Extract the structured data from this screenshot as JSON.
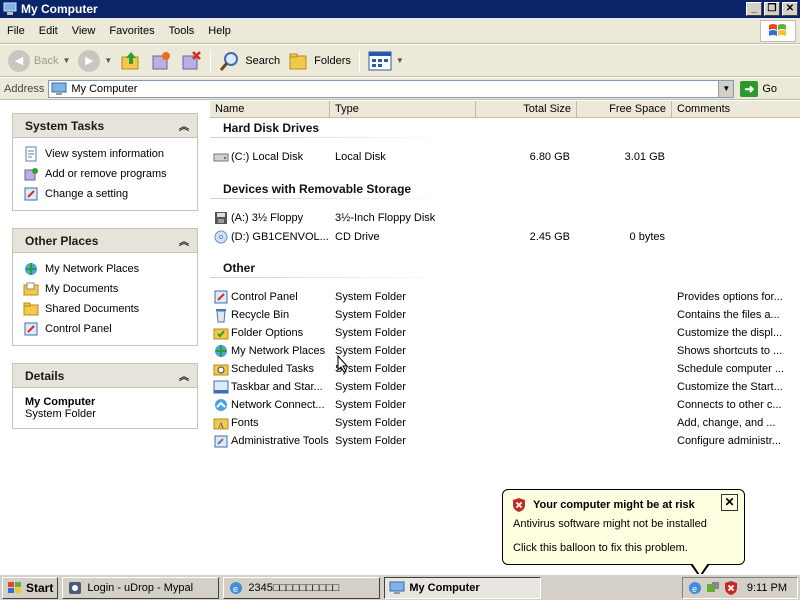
{
  "window": {
    "title": "My Computer"
  },
  "menu": [
    "File",
    "Edit",
    "View",
    "Favorites",
    "Tools",
    "Help"
  ],
  "toolbar": {
    "back": "Back",
    "search": "Search",
    "folders": "Folders"
  },
  "address": {
    "label": "Address",
    "value": "My Computer",
    "go": "Go"
  },
  "system_tasks": {
    "title": "System Tasks",
    "items": [
      "View system information",
      "Add or remove programs",
      "Change a setting"
    ]
  },
  "other_places": {
    "title": "Other Places",
    "items": [
      "My Network Places",
      "My Documents",
      "Shared Documents",
      "Control Panel"
    ]
  },
  "details": {
    "title": "Details",
    "name": "My Computer",
    "type": "System Folder"
  },
  "columns": [
    "Name",
    "Type",
    "Total Size",
    "Free Space",
    "Comments"
  ],
  "groups": {
    "hdd": {
      "title": "Hard Disk Drives",
      "rows": [
        {
          "name": "(C:) Local Disk",
          "type": "Local Disk",
          "total": "6.80 GB",
          "free": "3.01 GB",
          "comment": ""
        }
      ]
    },
    "removable": {
      "title": "Devices with Removable Storage",
      "rows": [
        {
          "name": "(A:) 3½ Floppy",
          "type": "3½-Inch Floppy Disk",
          "total": "",
          "free": "",
          "comment": ""
        },
        {
          "name": "(D:) GB1CENVOL...",
          "type": "CD Drive",
          "total": "2.45 GB",
          "free": "0 bytes",
          "comment": ""
        }
      ]
    },
    "other": {
      "title": "Other",
      "rows": [
        {
          "name": "Control Panel",
          "type": "System Folder",
          "comment": "Provides options for..."
        },
        {
          "name": "Recycle Bin",
          "type": "System Folder",
          "comment": "Contains the files a..."
        },
        {
          "name": "Folder Options",
          "type": "System Folder",
          "comment": "Customize the displ..."
        },
        {
          "name": "My Network Places",
          "type": "System Folder",
          "comment": "Shows shortcuts to ..."
        },
        {
          "name": "Scheduled Tasks",
          "type": "System Folder",
          "comment": "Schedule computer ..."
        },
        {
          "name": "Taskbar and Star...",
          "type": "System Folder",
          "comment": "Customize the Start..."
        },
        {
          "name": "Network Connect...",
          "type": "System Folder",
          "comment": "Connects to other c..."
        },
        {
          "name": "Fonts",
          "type": "System Folder",
          "comment": "Add, change, and ..."
        },
        {
          "name": "Administrative Tools",
          "type": "System Folder",
          "comment": "Configure administr..."
        }
      ]
    }
  },
  "balloon": {
    "title": "Your computer might be at risk",
    "line1": "Antivirus software might not be installed",
    "line2": "Click this balloon to fix this problem."
  },
  "taskbar": {
    "start": "Start",
    "tasks": [
      "Login - uDrop - Mypal",
      "2345□□□□□□□□□□",
      "My Computer"
    ],
    "clock": "9:11 PM"
  },
  "colors": {
    "title_bar": "#0a246a",
    "toolbar_bg": "#ece9d8",
    "balloon_bg": "#ffffe1"
  }
}
